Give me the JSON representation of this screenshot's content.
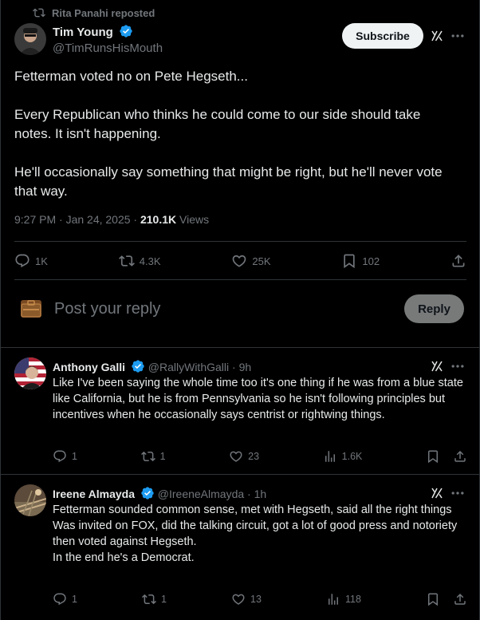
{
  "repost": {
    "label": "Rita Panahi reposted"
  },
  "tweet": {
    "author_name": "Tim Young",
    "author_handle": "@TimRunsHisMouth",
    "subscribe_label": "Subscribe",
    "lines": [
      "Fetterman voted no on Pete Hegseth...",
      "Every Republican who thinks he could come to our side should take notes.  It isn't happening.",
      "He'll occasionally say something that might be right, but he'll never vote that way."
    ],
    "time": "9:27 PM · Jan 24, 2025 · ",
    "views_count": "210.1K",
    "views_label": " Views",
    "stats": {
      "replies": "1K",
      "reposts": "4.3K",
      "likes": "25K",
      "bookmarks": "102"
    }
  },
  "reply_box": {
    "placeholder": "Post your reply",
    "button_label": "Reply"
  },
  "comments": [
    {
      "name": "Anthony Galli",
      "handle": "@RallyWithGalli",
      "time": "· 9h",
      "text": "Like I've been saying the whole time too it's one thing if he was from a blue state like California, but he is from Pennsylvania so he isn't following principles but incentives when he occasionally says centrist or rightwing things.",
      "replies": "1",
      "reposts": "1",
      "likes": "23",
      "views": "1.6K"
    },
    {
      "name": "Ireene Almayda",
      "handle": "@IreeneAlmayda",
      "time": "· 1h",
      "text_lines": [
        "Fetterman sounded common sense, met with Hegseth, said all the right things",
        "Was invited on FOX, did the talking circuit, got a lot of good press and notoriety then voted against Hegseth.",
        "In the end he's a Democrat."
      ],
      "replies": "1",
      "reposts": "1",
      "likes": "13",
      "views": "118"
    }
  ],
  "colors": {
    "background": "#000000",
    "text": "#e7e9ea",
    "muted": "#71767b",
    "verified": "#1d9bf0",
    "divider": "#2f3336"
  },
  "icons": [
    "repost-icon",
    "verified-icon",
    "grok-icon",
    "more-icon",
    "reply-icon",
    "like-icon",
    "bookmark-icon",
    "share-icon",
    "views-icon",
    "gif-box-icon"
  ]
}
